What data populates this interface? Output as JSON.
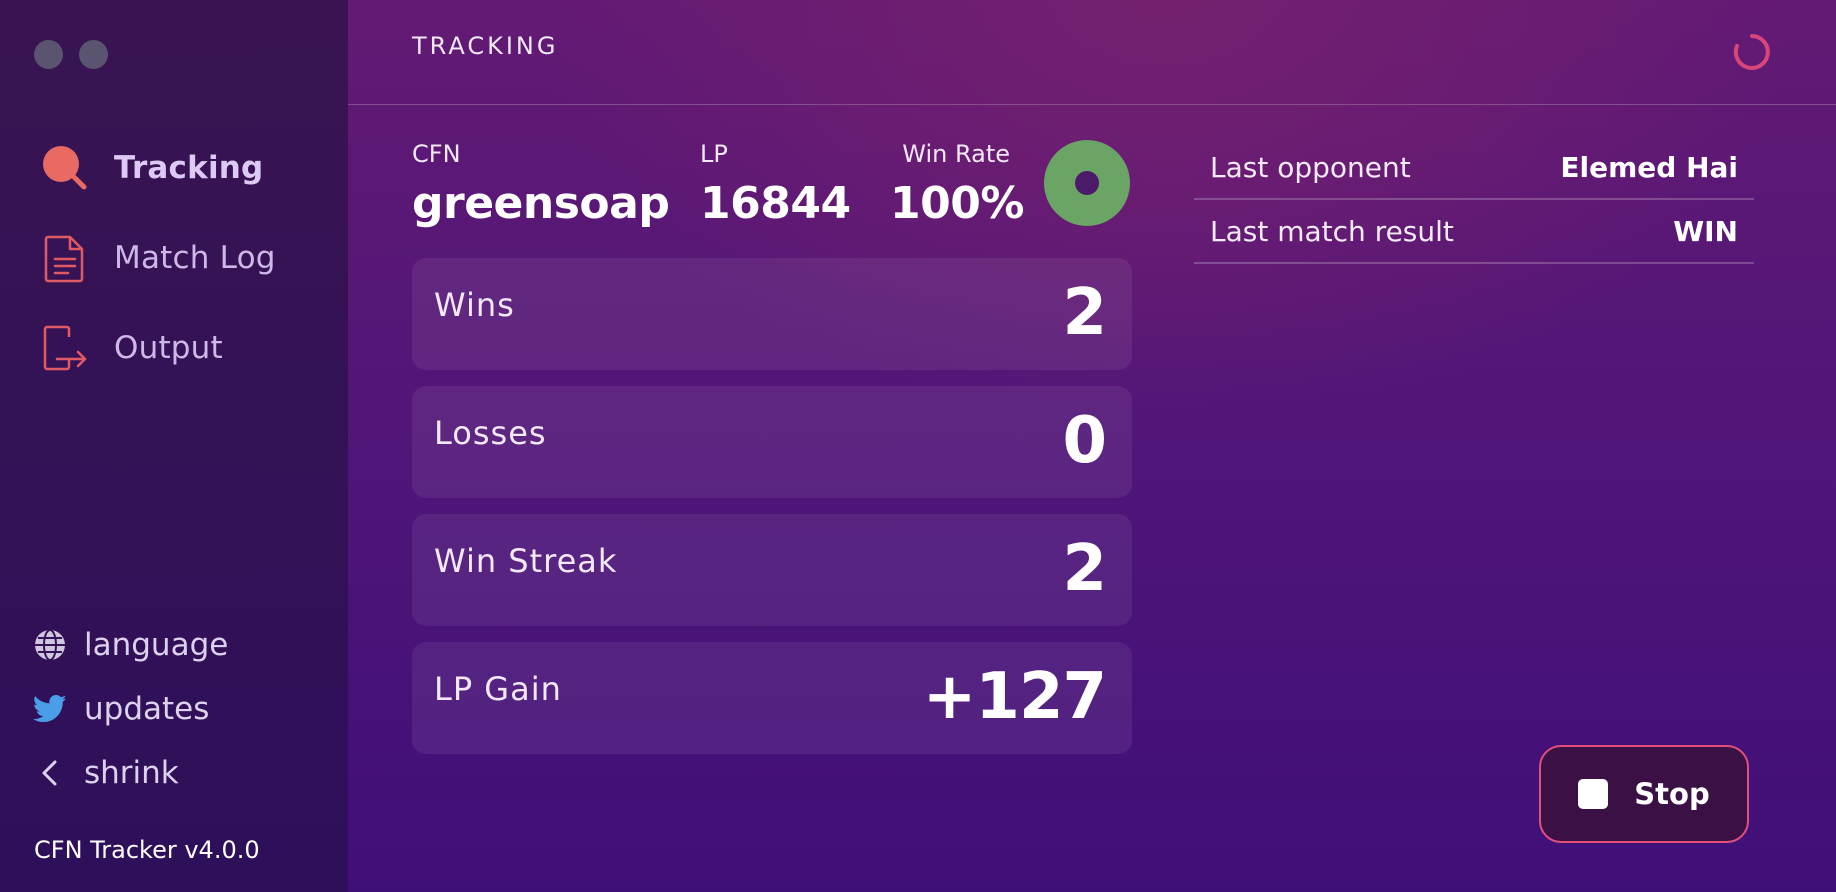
{
  "app": {
    "name": "CFN Tracker",
    "version_label": "CFN Tracker v4.0.0"
  },
  "sidebar": {
    "window_controls": [
      "window-button-close",
      "window-button-minimize"
    ],
    "nav": [
      {
        "label": "Tracking",
        "icon": "search-icon",
        "active": true
      },
      {
        "label": "Match Log",
        "icon": "document-icon",
        "active": false
      },
      {
        "label": "Output",
        "icon": "export-icon",
        "active": false
      }
    ],
    "links": [
      {
        "label": "language",
        "icon": "globe-icon"
      },
      {
        "label": "updates",
        "icon": "twitter-icon"
      },
      {
        "label": "shrink",
        "icon": "chevron-left-icon"
      }
    ]
  },
  "header": {
    "title": "TRACKING",
    "loading_icon": "spinner-icon"
  },
  "player": {
    "cfn_caption": "CFN",
    "cfn": "greensoap",
    "lp_caption": "LP",
    "lp": "16844",
    "winrate_caption": "Win Rate",
    "winrate": "100%",
    "status": "tracking-active"
  },
  "stats": [
    {
      "label": "Wins",
      "value": "2"
    },
    {
      "label": "Losses",
      "value": "0"
    },
    {
      "label": "Win Streak",
      "value": "2"
    },
    {
      "label": "LP Gain",
      "value": "+127"
    }
  ],
  "match_info": [
    {
      "label": "Last opponent",
      "value": "Elemed Hai"
    },
    {
      "label": "Last match result",
      "value": "WIN"
    }
  ],
  "controls": {
    "stop_label": "Stop"
  },
  "colors": {
    "accent": "#e05a64",
    "stop_border": "#e0507a",
    "status_green": "#6aa566",
    "sidebar_bg": "#341256",
    "main_bg": "#521678"
  }
}
